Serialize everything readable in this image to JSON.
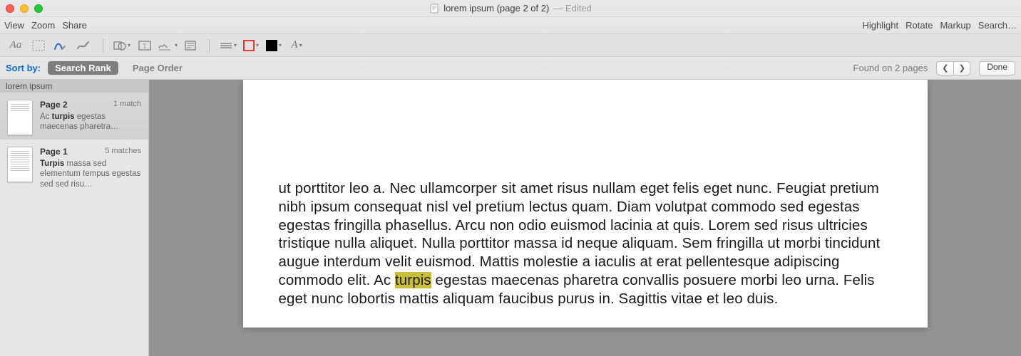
{
  "title": {
    "filename": "lorem ipsum (page 2 of 2)",
    "status": "— Edited"
  },
  "toolbar": {
    "view": "View",
    "zoom": "Zoom",
    "share": "Share",
    "highlight": "Highlight",
    "rotate": "Rotate",
    "markup": "Markup",
    "search": "Search…"
  },
  "markup": {
    "text_style_label": "Aa",
    "font_label": "A"
  },
  "search": {
    "sort_label": "Sort by:",
    "rank_label": "Search Rank",
    "page_order_label": "Page Order",
    "found_label": "Found on 2 pages",
    "done_label": "Done"
  },
  "sidebar": {
    "header": "lorem ipsum",
    "results": [
      {
        "title": "Page 2",
        "count": "1 match",
        "snippet_pre": "Ac ",
        "snippet_hl": "turpis",
        "snippet_post": " egestas maecenas pharetra…",
        "selected": true
      },
      {
        "title": "Page 1",
        "count": "5 matches",
        "snippet_pre": "",
        "snippet_hl": "Turpis",
        "snippet_post": " massa sed elementum tempus egestas sed sed risu…",
        "selected": false
      }
    ]
  },
  "document": {
    "body_pre": "ut porttitor leo a. Nec ullamcorper sit amet risus nullam eget felis eget nunc. Feugiat pretium nibh ipsum consequat nisl vel pretium lectus quam. Diam volutpat commodo sed egestas egestas fringilla phasellus. Arcu non odio euismod lacinia at quis. Lorem sed risus ultricies tristique nulla aliquet. Nulla porttitor massa id neque aliquam. Sem fringilla ut morbi tincidunt augue interdum velit euismod. Mattis molestie a iaculis at erat pellentesque adipiscing commodo elit. Ac ",
    "body_hl": "turpis",
    "body_post": " egestas maecenas pharetra convallis posuere morbi leo urna. Felis eget nunc lobortis mattis aliquam faucibus purus in. Sagittis vitae et leo duis."
  }
}
